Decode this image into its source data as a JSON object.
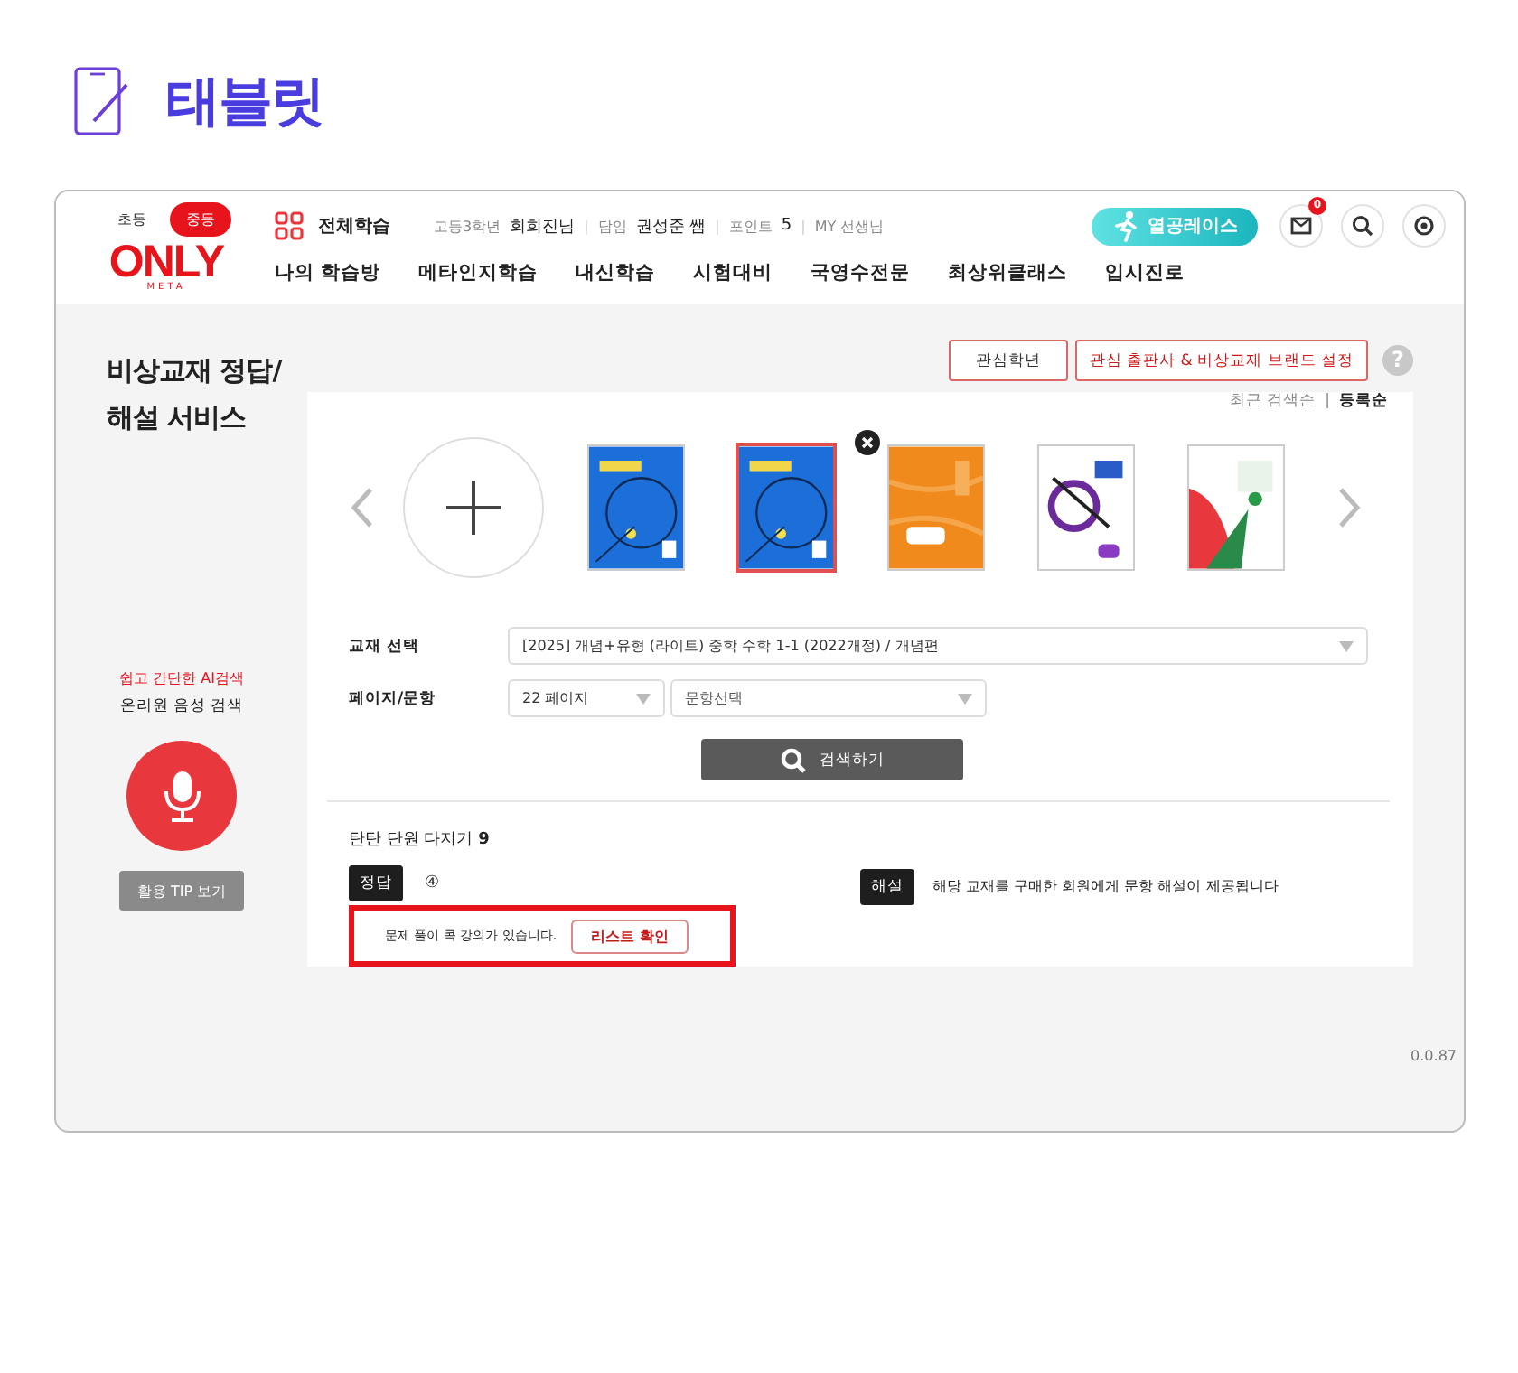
{
  "page_title": "태블릿",
  "header": {
    "levels": [
      {
        "label": "초등",
        "selected": false
      },
      {
        "label": "중등",
        "selected": true
      }
    ],
    "logo": {
      "text": "ONLY",
      "sub": "META"
    },
    "all_study": "전체학습",
    "user_info": [
      {
        "kind": "label",
        "text": "고등3학년"
      },
      {
        "kind": "value",
        "text": "회희진님"
      },
      {
        "kind": "sep",
        "text": "|"
      },
      {
        "kind": "label",
        "text": "담임"
      },
      {
        "kind": "value",
        "text": "권성준 쌤"
      },
      {
        "kind": "sep",
        "text": "|"
      },
      {
        "kind": "label",
        "text": "포인트"
      },
      {
        "kind": "value",
        "text": "5"
      },
      {
        "kind": "sep",
        "text": "|"
      },
      {
        "kind": "my",
        "text": "MY 선생님"
      }
    ],
    "race_button": "열공레이스",
    "mail_badge": "0",
    "nav": [
      "나의 학습방",
      "메타인지학습",
      "내신학습",
      "시험대비",
      "국영수전문",
      "최상위클래스",
      "입시진로"
    ]
  },
  "sidebar": {
    "title_lines": [
      "비상교재 정답/",
      "해설 서비스"
    ],
    "ai_label": "쉽고 간단한 AI검색",
    "voice_label": "온리원 음성 검색",
    "tip_button": "활용 TIP 보기"
  },
  "top_buttons": [
    {
      "label": "관심학년",
      "kind": "plain"
    },
    {
      "label": "관심 출판사 & 비상교재 브랜드 설정",
      "kind": "accent"
    }
  ],
  "help_icon": "?",
  "sort_separator": "|",
  "sort": [
    {
      "label": "최근 검색순",
      "selected": false
    },
    {
      "label": "등록순",
      "selected": true
    }
  ],
  "books": [
    {
      "selected": false,
      "removable": false
    },
    {
      "selected": true,
      "removable": false
    },
    {
      "selected": false,
      "removable": true
    },
    {
      "selected": false,
      "removable": false
    },
    {
      "selected": false,
      "removable": false
    }
  ],
  "form": {
    "textbook_label": "교재 선택",
    "textbook_value": "[2025] 개념+유형 (라이트) 중학 수학 1-1 (2022개정) / 개념편",
    "page_label": "페이지/문항",
    "page_value": "22 페이지",
    "question_placeholder": "문항선택",
    "search_button": "검색하기"
  },
  "result": {
    "title": "탄탄 단원 다지기 **9**",
    "answer_tag": "정답",
    "answer": "④",
    "lecture_text": "문제 풀이 콕 강의가 있습니다.",
    "list_button": "리스트 확인",
    "highlighted": true,
    "explain_tag": "해설",
    "explain_text": "해당 교재를 구매한 회원에게 문항 해설이 제공됩니다"
  },
  "version": "0.0.87"
}
